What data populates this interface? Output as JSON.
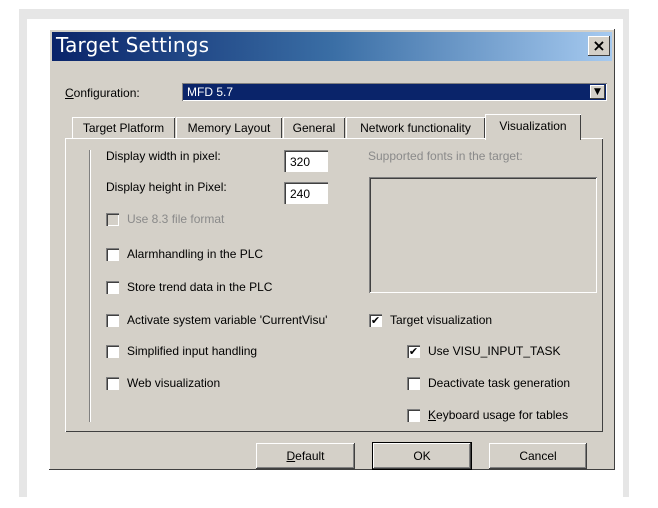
{
  "window": {
    "title": "Target Settings",
    "close_label": "×"
  },
  "configuration": {
    "label_prefix": "C",
    "label_rest": "onfiguration:",
    "value": "MFD 5.7",
    "dropdown_glyph": "▼"
  },
  "tabs": [
    {
      "label": "Target Platform"
    },
    {
      "label": "Memory Layout"
    },
    {
      "label": "General"
    },
    {
      "label": "Network functionality"
    },
    {
      "label": "Visualization",
      "active": true
    }
  ],
  "visualization": {
    "display_width_label": "Display width in pixel:",
    "display_width_value": "320",
    "display_height_label": "Display height in Pixel:",
    "display_height_value": "240",
    "supported_fonts_label": "Supported fonts in the target:",
    "checkboxes": {
      "use83": {
        "label": "Use 8.3 file format",
        "checked": false,
        "enabled": false
      },
      "alarmhandling": {
        "label": "Alarmhandling in the PLC",
        "checked": false
      },
      "store_trend": {
        "label": "Store trend data in the PLC",
        "checked": false
      },
      "activate_sysvar": {
        "label": "Activate system variable 'CurrentVisu'",
        "checked": false
      },
      "simplified_input": {
        "label": "Simplified input handling",
        "checked": false
      },
      "web_visu": {
        "label": "Web visualization",
        "checked": false
      },
      "target_visu": {
        "label": "Target visualization",
        "checked": true
      },
      "use_visu_input": {
        "label": "Use VISU_INPUT_TASK",
        "checked": true
      },
      "deactivate_task": {
        "label": "Deactivate task generation",
        "checked": false
      },
      "keyboard_usage": {
        "label_prefix": "K",
        "label_rest": "eyboard usage for tables",
        "checked": false
      }
    },
    "check_glyph": "✔"
  },
  "buttons": {
    "default_prefix": "D",
    "default_rest": "efault",
    "ok": "OK",
    "cancel": "Cancel"
  }
}
